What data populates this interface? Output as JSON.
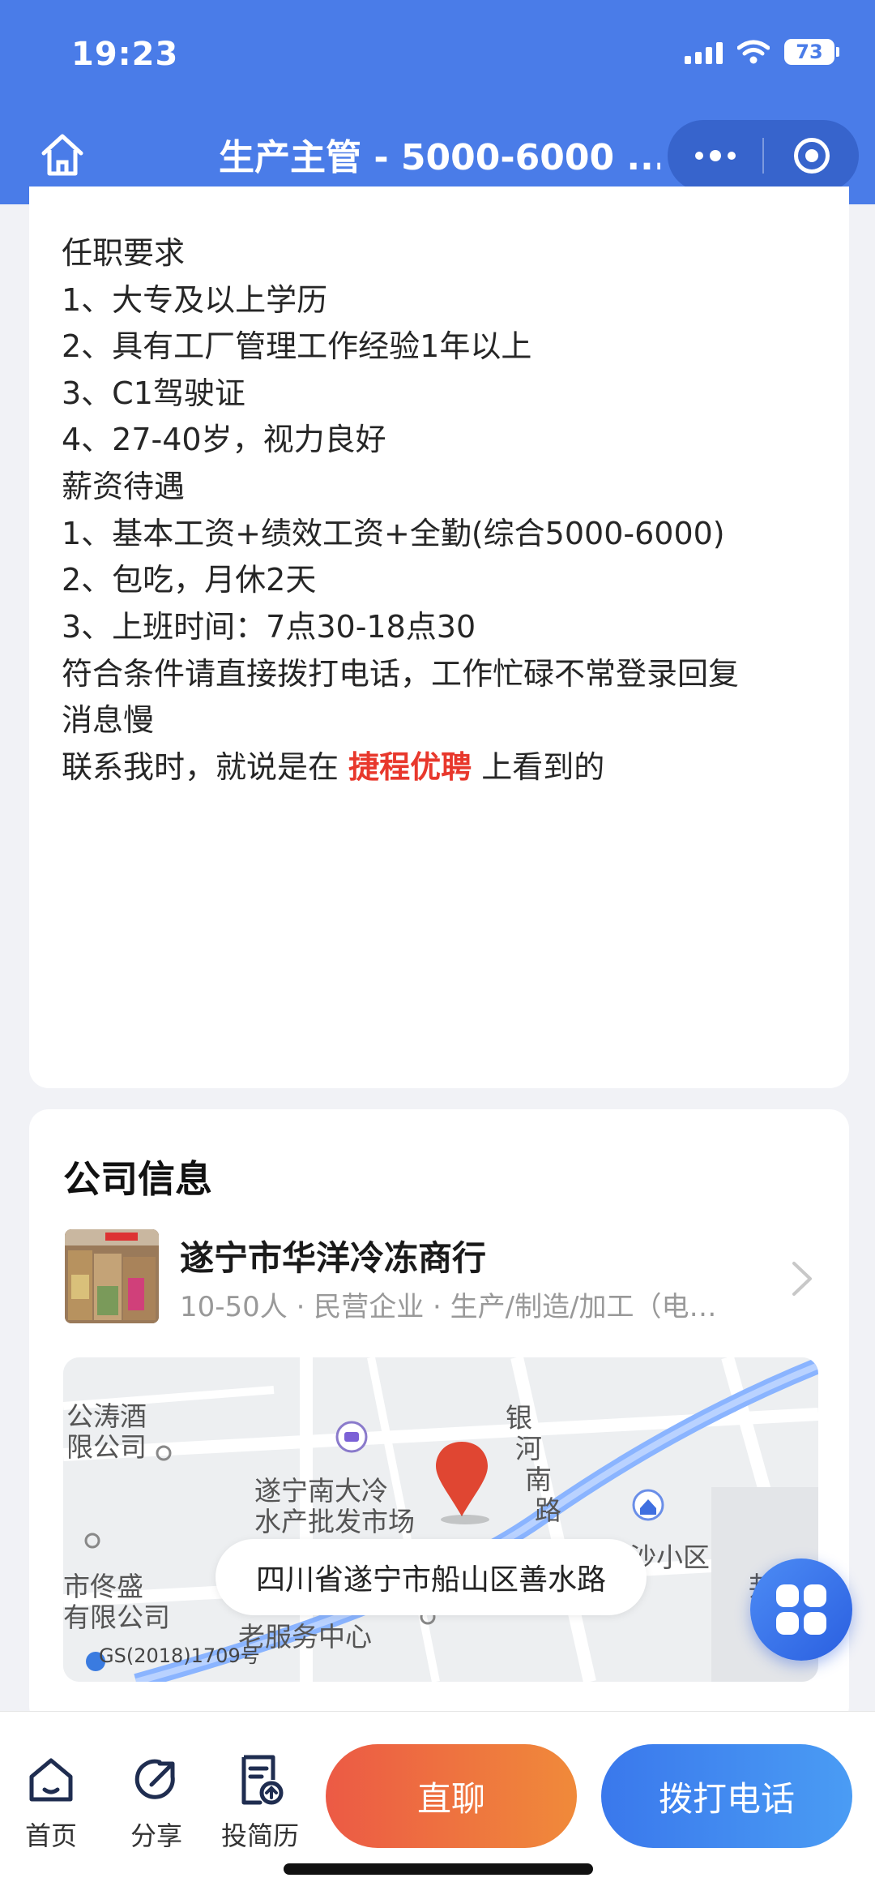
{
  "status_bar": {
    "time": "19:23",
    "battery": "73"
  },
  "nav": {
    "title": "生产主管 - 5000-6000 ..."
  },
  "requirements": {
    "lines": [
      "任职要求",
      "1、大专及以上学历",
      "2、具有工厂管理工作经验1年以上",
      "3、C1驾驶证",
      "4、27-40岁，视力良好",
      "薪资待遇",
      "1、基本工资+绩效工资+全勤(综合5000-6000)",
      "2、包吃，月休2天",
      "3、上班时间：7点30-18点30",
      "符合条件请直接拨打电话，工作忙碌不常登录回复",
      "消息慢"
    ],
    "contact_prefix": "联系我时，就说是在",
    "contact_brand": "捷程优聘",
    "contact_suffix": "上看到的"
  },
  "company": {
    "heading": "公司信息",
    "name": "遂宁市华洋冷冻商行",
    "meta": "10-50人 · 民营企业 · 生产/制造/加工（电…"
  },
  "map": {
    "address": "四川省遂宁市船山区善水路",
    "labels": {
      "l1": "公涛酒",
      "l2": "限公司",
      "l3": "遂宁南大冷",
      "l4": "水产批发市场",
      "l5": "银",
      "l6": "河",
      "l7": "南",
      "l8": "路",
      "l9": "市佟盛",
      "l10": "有限公司",
      "l11": "老服务中心",
      "l12": "邦",
      "l13": "金沙小区"
    },
    "credit": "GS(2018)1709号"
  },
  "bottom": {
    "tabs": [
      "首页",
      "分享",
      "投简历"
    ],
    "chat_label": "直聊",
    "call_label": "拨打电话"
  },
  "colors": {
    "header": "#4a7ce8",
    "brand": "#e8382c",
    "chat_button": "#ec5a45",
    "call_button": "#3a78ec"
  }
}
